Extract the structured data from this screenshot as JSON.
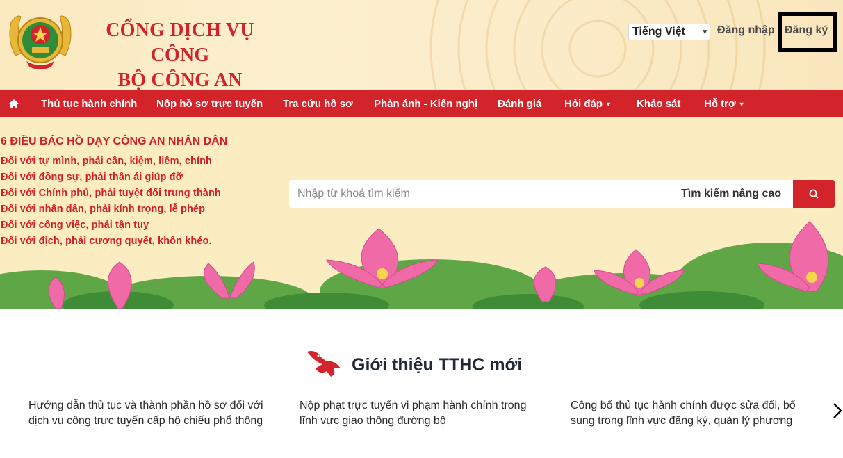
{
  "header": {
    "title_line1": "CỔNG DỊCH VỤ CÔNG",
    "title_line2": "BỘ CÔNG AN",
    "language": "Tiếng Việt",
    "login_label": "Đăng nhập",
    "register_label": "Đăng ký",
    "logo_icon": "police-emblem-icon"
  },
  "nav": {
    "home_icon": "home-icon",
    "items": [
      {
        "label": "Thủ tục hành chính"
      },
      {
        "label": "Nộp hồ sơ trực tuyến"
      },
      {
        "label": "Tra cứu hồ sơ"
      },
      {
        "label": "Phản ánh - Kiến nghị"
      },
      {
        "label": "Đánh giá"
      },
      {
        "label": "Hỏi đáp"
      },
      {
        "label": "Khảo sát"
      },
      {
        "label": "Hỗ trợ"
      }
    ]
  },
  "banner": {
    "teachings_title": "6 ĐIỀU BÁC HỒ DẠY CÔNG AN NHÂN DÂN",
    "teachings": [
      "Đối với tự mình, phải cần, kiệm, liêm, chính",
      "Đối với đồng sự, phải thân ái giúp đỡ",
      "Đối với Chính phủ, phải tuyệt đối trung thành",
      "Đối với nhân dân, phải kính trọng, lễ phép",
      "Đối với công việc, phải tận tụy",
      "Đối với địch, phải cương quyết, khôn khéo."
    ]
  },
  "search": {
    "placeholder": "Nhập từ khoá tìm kiếm",
    "advanced_label": "Tìm kiếm nâng cao",
    "button_icon": "search-icon"
  },
  "intro": {
    "title": "Giới thiệu TTHC mới",
    "cards": [
      {
        "line1": "Hướng dẫn thủ tục và thành phần hồ sơ đối với",
        "line2": "dịch vụ công trực tuyến cấp hộ chiếu phổ thông"
      },
      {
        "line1": "Nộp phạt trực tuyến vi phạm hành chính trong",
        "line2": "lĩnh vực giao thông đường bộ"
      },
      {
        "line1": "Công bố thủ tục hành chính được sửa đổi, bổ",
        "line2": "sung trong lĩnh vực đăng ký, quản lý phương"
      }
    ],
    "next_icon": "chevron-right-icon"
  },
  "colors": {
    "brand_red": "#d3232b",
    "banner_bg": "#fcecc1",
    "lotus_pink": "#f06aa8"
  }
}
